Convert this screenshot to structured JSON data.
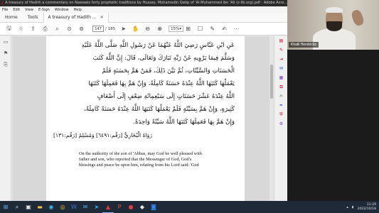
{
  "window": {
    "title": "A treasury of Hadith a commentary on Nawawis forty prophetic traditions by Hussey, Mohamedin Qatip of 'Al-Muhammed ibn 'Ali (z-lib.org).pdf - Adobe Acro..."
  },
  "menu": [
    "File",
    "Edit",
    "View",
    "E-Sign",
    "Window",
    "Help"
  ],
  "tabs": {
    "home": "Home",
    "tools": "Tools",
    "document": "A treasury of Hadith ..."
  },
  "toolbar": {
    "page_current": "147",
    "page_total": "/ 185",
    "zoom": "15%"
  },
  "document": {
    "arabic_lines": [
      "عَنِ ابْنِ عَبَّاسٍ رَضِيَ اللَّهُ عَنْهُمَا عَنْ رَسُولِ اللَّهِ صَلَّى اللَّهُ عَلَيْهِ",
      "وَسَلَّمَ فِيمَا يَرْوِيهِ عَنْ رَبِّهِ تَبَارَكَ وَتَعَالَى، قَالَ: إِنَّ اللَّهَ كَتَبَ",
      "الْحَسَنَاتِ وَالسَّيِّئَاتِ، ثُمَّ بَيَّنَ ذَلِكَ، فَمَنْ هَمَّ بِحَسَنَةٍ فَلَمْ",
      "يَعْمَلْهَا كَتَبَهَا اللَّهُ عِنْدَهُ حَسَنَةً كَامِلَةً، وَإِنْ هَمَّ بِهَا فَعَمِلَهَا كَتَبَهَا",
      "اللَّهُ عِنْدَهُ عَشْرَ حَسَنَاتٍ إِلَى سَبْعِمِائَةِ ضِعْفٍ إِلَى أَضْعَافٍ",
      "كَثِيرَةٍ، وَإِنْ هَمَّ بِسَيِّئَةٍ فَلَمْ يَعْمَلْهَا كَتَبَهَا اللَّهُ عِنْدَهُ حَسَنَةً كَامِلَةً،",
      "وَإِنْ هَمَّ بِهَا فَعَمِلَهَا كَتَبَهَا اللَّهُ سَيِّئَةً وَاحِدَةً."
    ],
    "arabic_source": "رَوَاهُ الْبُخَارِيُّ [رَقْم:٦٤٩١] وَمُسْلِمٌ [رَقْم:١٣١]",
    "english_lines": [
      "On the authority of the son of 'Abbas, may God be well pleased with",
      "father and son, who reported that the Messenger of God, God's",
      "blessings and peace be upon him, relating from his Lord said: 'God"
    ]
  },
  "webcam": {
    "name": "Khalil Hendricks"
  },
  "taskbar": {
    "time": "11:29",
    "date": "2022/10/18"
  },
  "colors": {
    "titlebar": "#2b2b2b",
    "taskbar": "#1f2a38",
    "acrobat_red": "#d0021b"
  }
}
